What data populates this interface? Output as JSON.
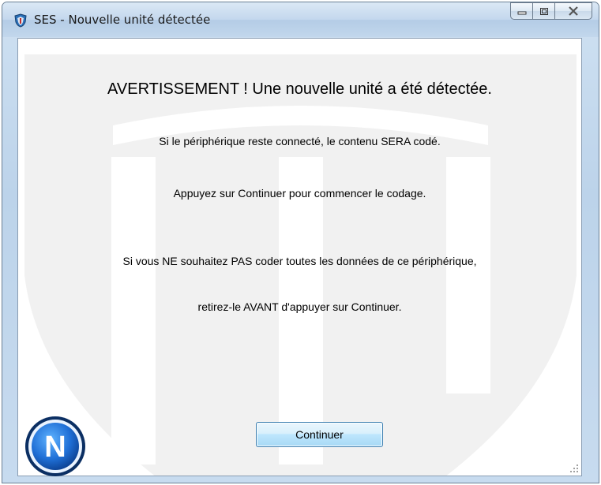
{
  "window": {
    "title": "SES - Nouvelle unité détectée",
    "icons": {
      "app": "ses-app-icon",
      "minimize": "minimize-icon",
      "maximize": "maximize-icon",
      "close": "close-icon"
    }
  },
  "message": {
    "heading": "AVERTISSEMENT ! Une nouvelle unité a été détectée.",
    "line1": "Si le périphérique reste connecté, le contenu SERA codé.",
    "line2": "Appuyez sur Continuer pour commencer le codage.",
    "line3": "Si vous NE souhaitez PAS coder toutes les données de ce périphérique,",
    "line4": "retirez-le AVANT d'appuyer sur Continuer."
  },
  "actions": {
    "continue_label": "Continuer"
  },
  "branding": {
    "badge_letter": "N",
    "badge_icon": "n-logo-badge-icon"
  },
  "colors": {
    "badge": "#1f6fd6",
    "button_border": "#3c7fb1",
    "watermark": "#f0f0f0"
  }
}
